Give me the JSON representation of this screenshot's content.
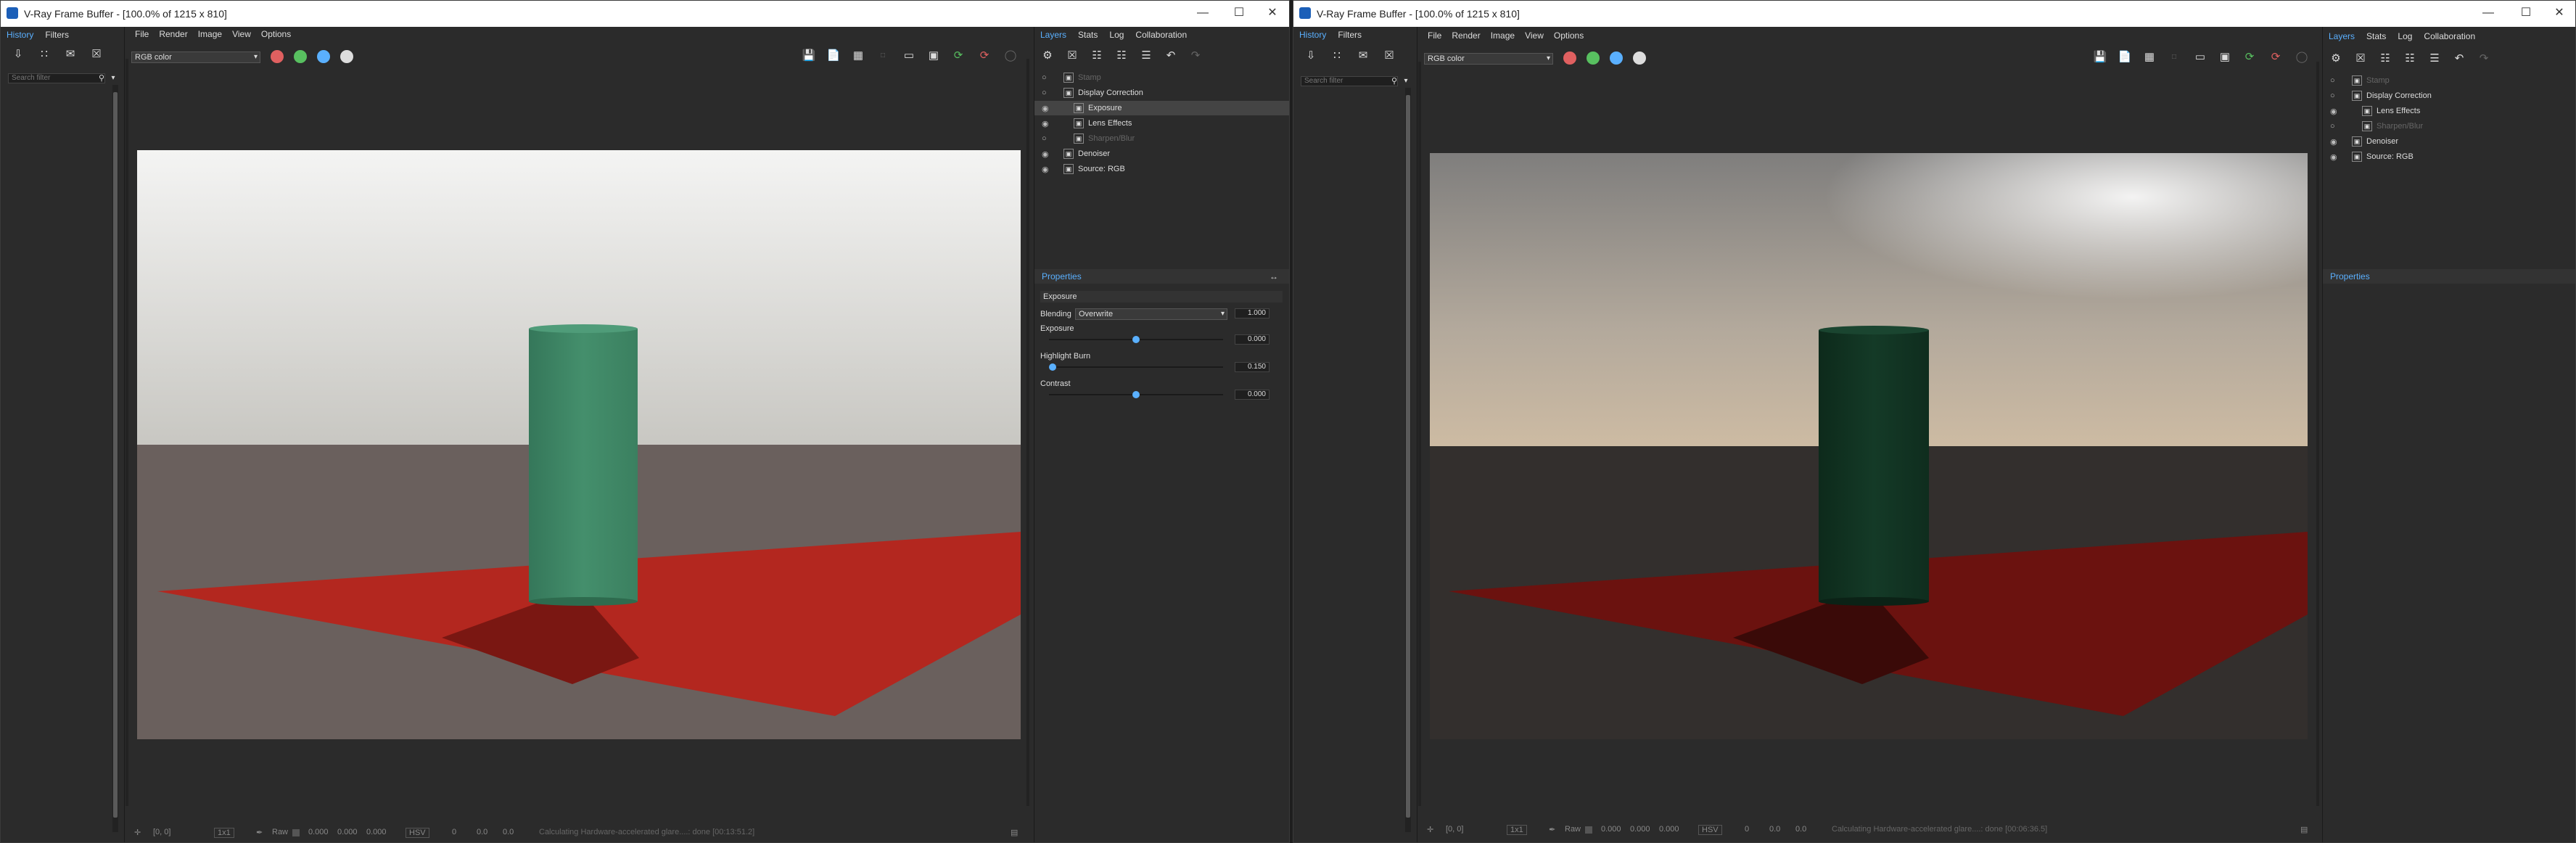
{
  "windows": [
    {
      "title": "V-Ray Frame Buffer - [100.0% of 1215 x 810]",
      "left_tabs": [
        "History",
        "Filters"
      ],
      "search_placeholder": "Search filter",
      "menu": [
        "File",
        "Render",
        "Image",
        "View",
        "Options"
      ],
      "channel_select": "RGB color",
      "right_tabs": [
        "Layers",
        "Stats",
        "Log",
        "Collaboration"
      ],
      "layers": [
        {
          "name": "Stamp",
          "icon": "stamp-icon",
          "visible": false,
          "dim": true,
          "indent": 0
        },
        {
          "name": "Display Correction",
          "icon": "display-correction-icon",
          "visible": false,
          "dim": false,
          "indent": 0
        },
        {
          "name": "Exposure",
          "icon": "exposure-icon",
          "visible": true,
          "dim": false,
          "indent": 1,
          "selected": true
        },
        {
          "name": "Lens Effects",
          "icon": "lens-effects-icon",
          "visible": true,
          "dim": false,
          "indent": 1
        },
        {
          "name": "Sharpen/Blur",
          "icon": "sharpen-icon",
          "visible": false,
          "dim": true,
          "indent": 1
        },
        {
          "name": "Denoiser",
          "icon": "denoiser-icon",
          "visible": true,
          "dim": false,
          "indent": 0
        },
        {
          "name": "Source: RGB",
          "icon": "source-rgb-icon",
          "visible": true,
          "dim": false,
          "indent": 0
        }
      ],
      "properties_title": "Properties",
      "properties": {
        "group": "Exposure",
        "blending_label": "Blending",
        "blending_value": "Overwrite",
        "blending_amount": "1.000",
        "exposure_label": "Exposure",
        "exposure_value": "0.000",
        "exposure_level": 0.5,
        "highlight_label": "Highlight Burn",
        "highlight_value": "0.150",
        "highlight_level": 0.02,
        "contrast_label": "Contrast",
        "contrast_value": "0.000",
        "contrast_level": 0.5
      },
      "status": {
        "coords": "[0, 0]",
        "zoom": "1x1",
        "mode": "Raw",
        "rgb": [
          "0.000",
          "0.000",
          "0.000"
        ],
        "colorspace": "HSV",
        "hsv": [
          "0",
          "0.0",
          "0.0"
        ],
        "message": "Calculating Hardware-accelerated glare....: done [00:13:51.2]"
      },
      "colors": {
        "sky_top": "#e9e9e7",
        "sky_bottom": "#c8c7c2",
        "ground": "#6a605d",
        "plane": "#b3271f",
        "cylinder": "#3e8a68"
      }
    },
    {
      "title": "V-Ray Frame Buffer - [100.0% of 1215 x 810]",
      "left_tabs": [
        "History",
        "Filters"
      ],
      "search_placeholder": "Search filter",
      "menu": [
        "File",
        "Render",
        "Image",
        "View",
        "Options"
      ],
      "channel_select": "RGB color",
      "right_tabs": [
        "Layers",
        "Stats",
        "Log",
        "Collaboration"
      ],
      "layers": [
        {
          "name": "Stamp",
          "icon": "stamp-icon",
          "visible": false,
          "dim": true,
          "indent": 0
        },
        {
          "name": "Display Correction",
          "icon": "display-correction-icon",
          "visible": false,
          "dim": false,
          "indent": 0
        },
        {
          "name": "Lens Effects",
          "icon": "lens-effects-icon",
          "visible": true,
          "dim": false,
          "indent": 1
        },
        {
          "name": "Sharpen/Blur",
          "icon": "sharpen-icon",
          "visible": false,
          "dim": true,
          "indent": 1
        },
        {
          "name": "Denoiser",
          "icon": "denoiser-icon",
          "visible": true,
          "dim": false,
          "indent": 0
        },
        {
          "name": "Source: RGB",
          "icon": "source-rgb-icon",
          "visible": true,
          "dim": false,
          "indent": 0
        }
      ],
      "properties_title": "Properties",
      "status": {
        "coords": "[0, 0]",
        "zoom": "1x1",
        "mode": "Raw",
        "rgb": [
          "0.000",
          "0.000",
          "0.000"
        ],
        "colorspace": "HSV",
        "hsv": [
          "0",
          "0.0",
          "0.0"
        ],
        "message": "Calculating Hardware-accelerated glare....: done [00:06:36.5]"
      },
      "colors": {
        "sky_top": "#8d8c8a",
        "sky_bottom": "#c9b9a4",
        "ground": "#332f2d",
        "plane": "#6b120f",
        "cylinder": "#10301f"
      }
    }
  ]
}
